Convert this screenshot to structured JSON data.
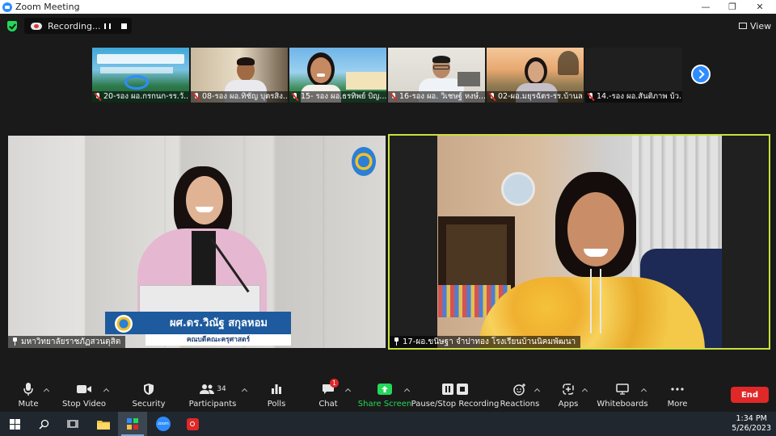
{
  "window": {
    "title": "Zoom Meeting",
    "minimize": "—",
    "restore": "❐",
    "close": "✕"
  },
  "recording": {
    "status": "Recording..."
  },
  "view": {
    "label": "View"
  },
  "thumbnails": [
    {
      "name": "20-รอง ผอ.กรกนก-รร.วั..."
    },
    {
      "name": "08-รอง ผอ.ทิชัญ บุตรสิง..."
    },
    {
      "name": "15- รอง ผอ.ธรทิพย์ บิญ..."
    },
    {
      "name": "16-รอง ผอ. วิเชษฐ์ หงษ์..."
    },
    {
      "name": "02-ผอ.มยุรฉัตร-รร.บ้านล..."
    },
    {
      "name": "14.-รอง ผอ.สันติภาพ บ้ว..."
    }
  ],
  "main_left": {
    "participant": "มหาวิทยาลัยราชภัฏสวนดุสิต",
    "banner_name": "ผศ.ดร.วิณัฐ สกุลหอม",
    "banner_role": "คณบดีคณะครุศาสตร์"
  },
  "main_right": {
    "participant": "17-ผอ.ขนิษฐา จำปาทอง โรงเรียนบ้านนิคมพัฒนา"
  },
  "toolbar": {
    "mute": "Mute",
    "stop_video": "Stop Video",
    "security": "Security",
    "participants": "Participants",
    "participants_count": "34",
    "polls": "Polls",
    "chat": "Chat",
    "chat_badge": "1",
    "share_screen": "Share Screen",
    "pause_recording": "Pause/Stop Recording",
    "reactions": "Reactions",
    "apps": "Apps",
    "whiteboards": "Whiteboards",
    "more": "More",
    "end": "End"
  },
  "taskbar": {
    "time": "1:34 PM",
    "date": "5/26/2023"
  },
  "colors": {
    "accent": "#2d8cff",
    "active_speaker": "#c9e13c",
    "share": "#23d959",
    "end": "#e02828"
  }
}
